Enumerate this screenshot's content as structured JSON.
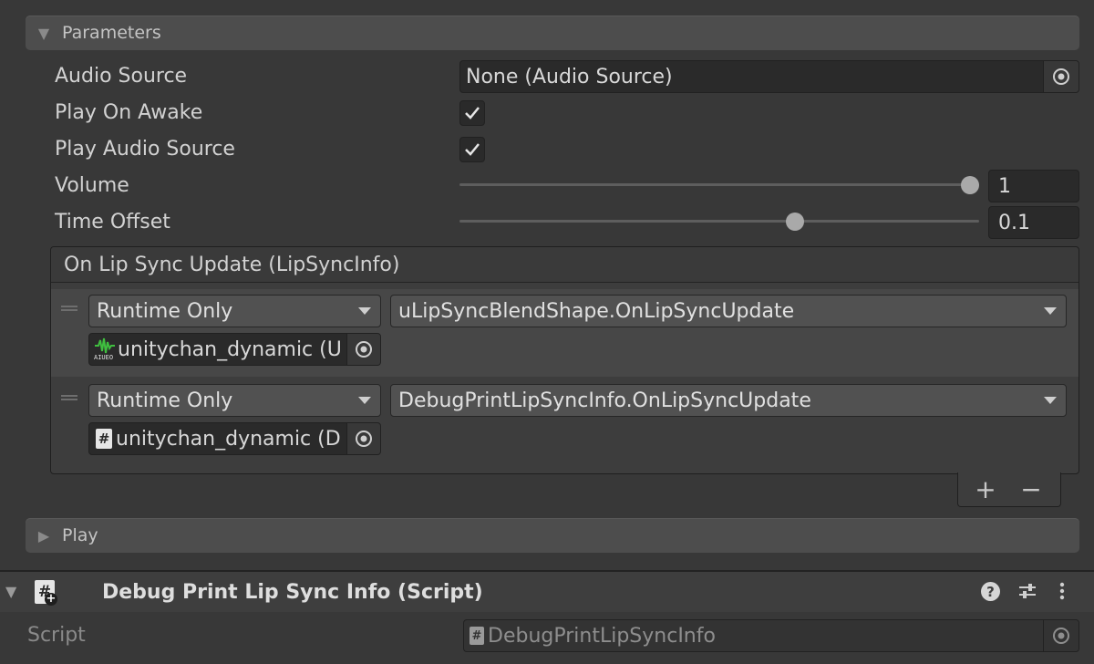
{
  "parameters": {
    "header": "Parameters",
    "rows": {
      "audio_source": {
        "label": "Audio Source",
        "value": "None (Audio Source)"
      },
      "play_on_awake": {
        "label": "Play On Awake",
        "checked": true
      },
      "play_audio_source": {
        "label": "Play Audio Source",
        "checked": true
      },
      "volume": {
        "label": "Volume",
        "value": "1",
        "level": 1.0
      },
      "time_offset": {
        "label": "Time Offset",
        "value": "0.1",
        "level": 0.65
      }
    },
    "event": {
      "title": "On Lip Sync Update (LipSyncInfo)",
      "listeners": [
        {
          "mode": "Runtime Only",
          "function": "uLipSyncBlendShape.OnLipSyncUpdate",
          "target": "unitychan_dynamic (U",
          "target_icon": "audio-component-icon",
          "icon_caption": "AIUEO"
        },
        {
          "mode": "Runtime Only",
          "function": "DebugPrintLipSyncInfo.OnLipSyncUpdate",
          "target": "unitychan_dynamic (D",
          "target_icon": "script-icon",
          "icon_caption": "#"
        }
      ],
      "add_label": "+",
      "remove_label": "−"
    }
  },
  "play_foldout": {
    "header": "Play"
  },
  "component": {
    "title": "Debug Print Lip Sync Info (Script)",
    "icon_glyph": "#",
    "help_glyph": "?",
    "script_label": "Script",
    "script_value": "DebugPrintLipSyncInfo",
    "script_glyph": "#"
  },
  "colors": {
    "background": "#383838",
    "foldout": "#4d4d4d",
    "field": "#2a2a2a",
    "audio_icon": "#3fbf3f"
  }
}
